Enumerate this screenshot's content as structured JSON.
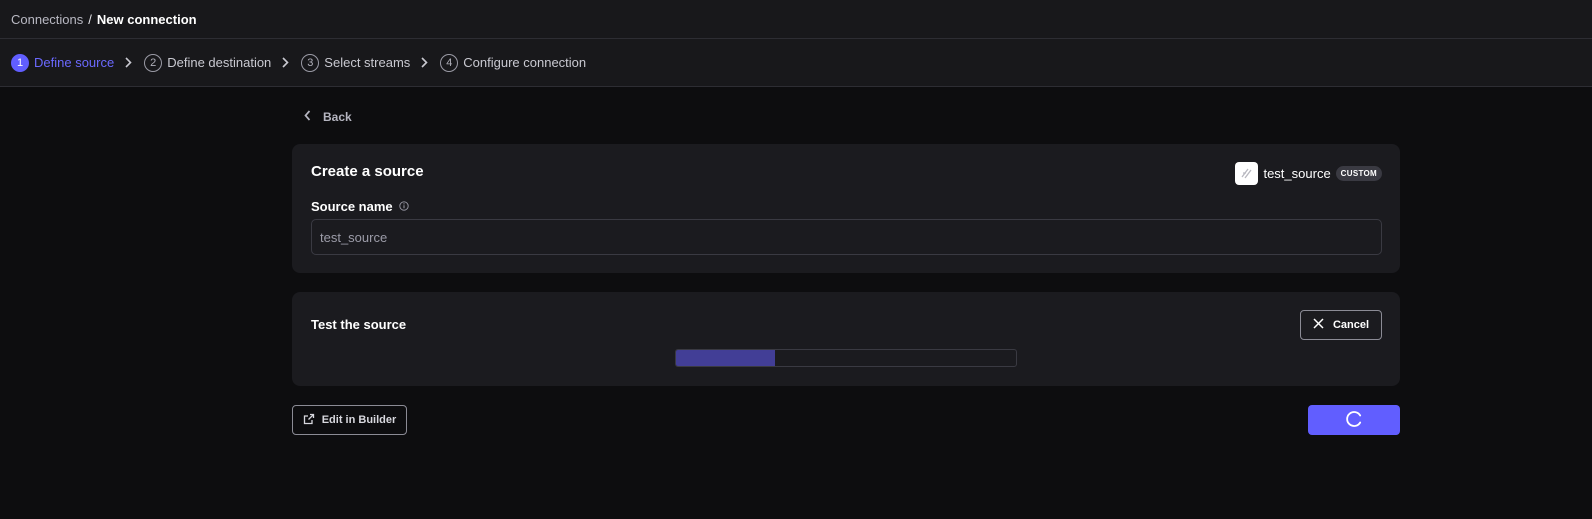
{
  "breadcrumb": {
    "parent": "Connections",
    "separator": "/",
    "current": "New connection"
  },
  "steps": [
    {
      "num": "1",
      "label": "Define source",
      "active": true
    },
    {
      "num": "2",
      "label": "Define destination",
      "active": false
    },
    {
      "num": "3",
      "label": "Select streams",
      "active": false
    },
    {
      "num": "4",
      "label": "Configure connection",
      "active": false
    }
  ],
  "back_label": "Back",
  "create_card": {
    "title": "Create a source",
    "source_badge": {
      "name": "test_source",
      "tag": "CUSTOM"
    },
    "field_label": "Source name",
    "field_value": "test_source"
  },
  "test_card": {
    "title": "Test the source",
    "cancel_label": "Cancel",
    "progress": 0.29
  },
  "footer": {
    "edit_label": "Edit in Builder"
  },
  "colors": {
    "accent": "#615eff",
    "progress_fill": "#423e96",
    "background": "#0d0d0f",
    "card": "#1b1b1f"
  },
  "icons": [
    "chevron-right-icon",
    "chevron-left-icon",
    "info-icon",
    "builder-logo-icon",
    "close-icon",
    "external-link-icon",
    "spinner-icon"
  ]
}
